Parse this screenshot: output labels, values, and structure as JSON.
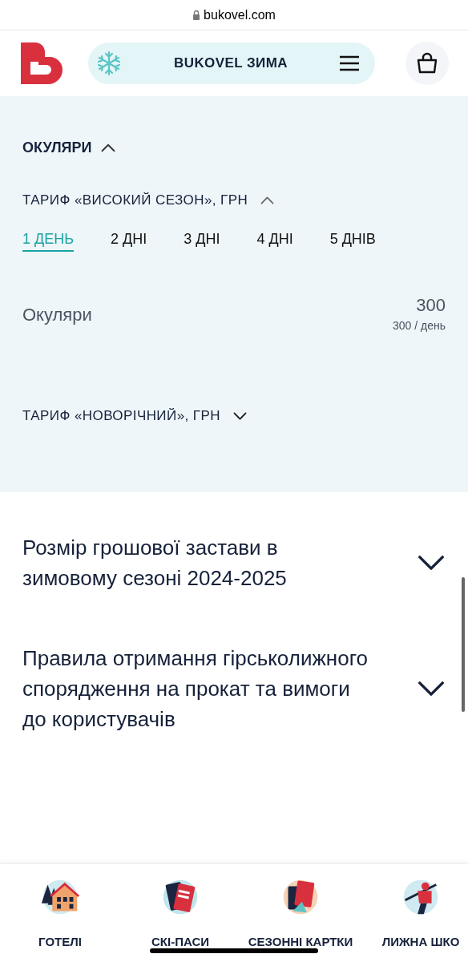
{
  "browser": {
    "url": "bukovel.com"
  },
  "header": {
    "title": "BUKOVEL ЗИМА"
  },
  "section": {
    "title": "ОКУЛЯРИ",
    "expanded": true,
    "tariffs": [
      {
        "title": "ТАРИФ «ВИСОКИЙ СЕЗОН», ГРН",
        "expanded": true,
        "tabs": [
          {
            "label": "1 ДЕНЬ",
            "selected": true
          },
          {
            "label": "2 ДНІ",
            "selected": false
          },
          {
            "label": "3 ДНІ",
            "selected": false
          },
          {
            "label": "4 ДНІ",
            "selected": false
          },
          {
            "label": "5 ДНІВ",
            "selected": false
          }
        ],
        "rows": [
          {
            "name": "Окуляри",
            "price": "300",
            "per_day": "300 / день"
          }
        ]
      },
      {
        "title": "ТАРИФ «НОВОРІЧНИЙ», ГРН",
        "expanded": false
      }
    ]
  },
  "faq": [
    {
      "question": "Розмір грошової застави в зимовому сезоні 2024-2025",
      "expanded": false
    },
    {
      "question": "Правила отримання гірськолижного спорядження на прокат та вимоги до користувачів",
      "expanded": false
    }
  ],
  "bottom_nav": [
    {
      "label": "ГОТЕЛІ",
      "kind": "hotel"
    },
    {
      "label": "СКІ-ПАСИ",
      "kind": "skipass"
    },
    {
      "label": "СЕЗОННІ КАРТКИ",
      "kind": "season"
    },
    {
      "label": "ЛИЖНА ШКО",
      "kind": "school"
    }
  ]
}
